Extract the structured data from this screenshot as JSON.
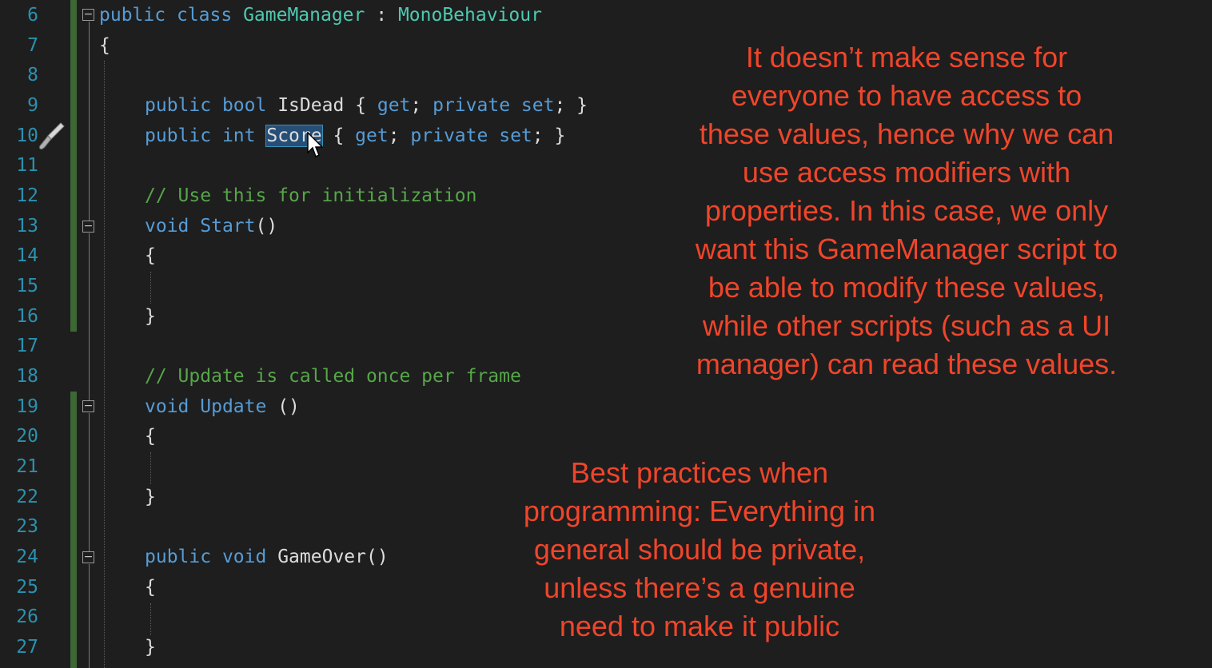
{
  "editor": {
    "line_numbers": [
      "6",
      "7",
      "8",
      "9",
      "10",
      "11",
      "12",
      "13",
      "14",
      "15",
      "16",
      "17",
      "18",
      "19",
      "20",
      "21",
      "22",
      "23",
      "24",
      "25",
      "26",
      "27"
    ],
    "code": {
      "l6": {
        "kw1": "public",
        "kw2": "class",
        "name": "GameManager",
        "colon": " : ",
        "base": "MonoBehaviour"
      },
      "l7": "{",
      "l9": {
        "kw1": "public",
        "kw2": "bool",
        "name": "IsDead",
        "open": "{ ",
        "get": "get",
        "sep": "; ",
        "priv": "private",
        "set": "set",
        "close": "; }"
      },
      "l10": {
        "kw1": "public",
        "kw2": "int",
        "name": "Score",
        "open": "{ ",
        "get": "get",
        "sep": "; ",
        "priv": "private",
        "set": "set",
        "close": "; }"
      },
      "l12": "// Use this for initialization",
      "l13": {
        "kw": "void",
        "name": "Start",
        "parens": "()"
      },
      "l14": "{",
      "l16": "}",
      "l18": "// Update is called once per frame",
      "l19": {
        "kw": "void",
        "name": "Update",
        "parens": " ()"
      },
      "l20": "{",
      "l22": "}",
      "l24": {
        "kw1": "public",
        "kw2": "void",
        "name": "GameOver",
        "parens": "()"
      },
      "l25": "{",
      "l27": "}"
    }
  },
  "annotations": {
    "top": [
      "It doesn’t make sense for",
      "everyone to have access to",
      "these values, hence why we can",
      "use access modifiers with",
      "properties. In this case, we only",
      "want this GameManager script to",
      "be able to modify these values,",
      "while other scripts (such as a UI",
      "manager) can read these values."
    ],
    "bottom": [
      "Best practices when",
      "programming: Everything in",
      "general should be private,",
      "unless there’s a genuine",
      "need to make it public"
    ]
  },
  "icons": {
    "brush": "quick-action-brush-icon",
    "cursor": "mouse-pointer-icon",
    "fold": "collapse-icon"
  },
  "colors": {
    "background": "#1e1e1e",
    "keyword": "#569cd6",
    "type": "#4ec9b0",
    "comment": "#57a64a",
    "line_number": "#2b91af",
    "annotation": "#f0452a"
  }
}
